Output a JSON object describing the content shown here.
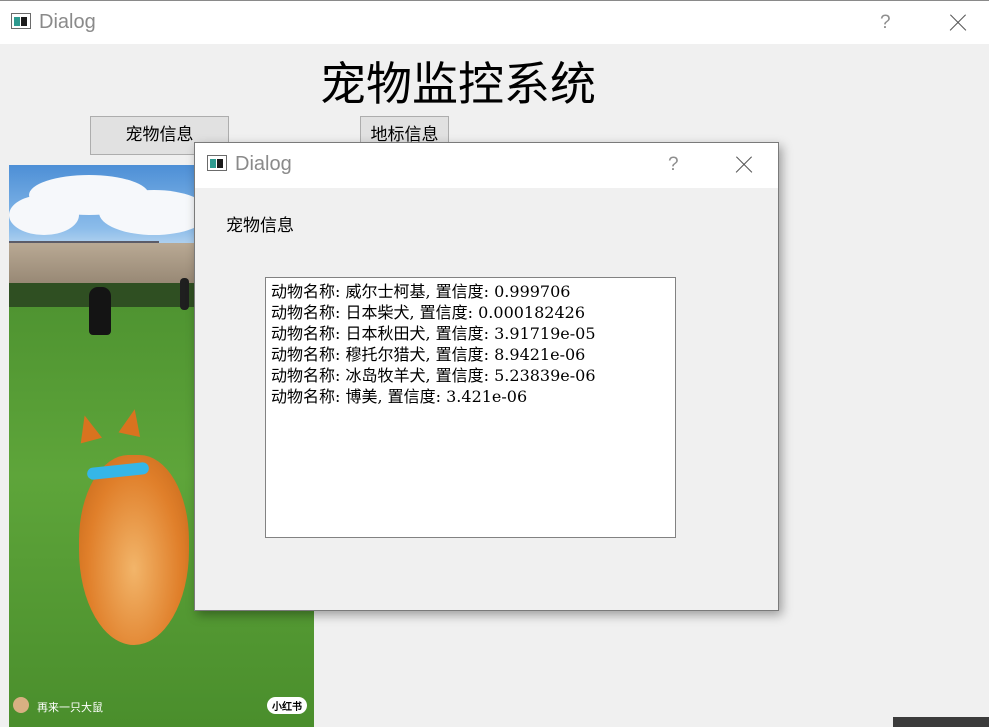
{
  "main_window": {
    "title": "Dialog",
    "help": "?",
    "heading": "宠物监控系统",
    "buttons": {
      "pet_info": "宠物信息",
      "landmark_info": "地标信息"
    }
  },
  "photo": {
    "caption": "再来一只大鼠",
    "badge": "小红书"
  },
  "dialog": {
    "title": "Dialog",
    "help": "?",
    "label": "宠物信息",
    "results": [
      "动物名称: 威尔士柯基, 置信度: 0.999706",
      "动物名称: 日本柴犬, 置信度: 0.000182426",
      "动物名称: 日本秋田犬, 置信度: 3.91719e-05",
      "动物名称: 穆托尔猎犬, 置信度: 8.9421e-06",
      "动物名称: 冰岛牧羊犬, 置信度: 5.23839e-06",
      "动物名称: 博美, 置信度: 3.421e-06"
    ]
  },
  "colors": {
    "teal_icon": "#2e9a8f",
    "collar": "#35b6e8"
  },
  "icons": [
    "app-icon",
    "help-icon",
    "close-icon"
  ]
}
